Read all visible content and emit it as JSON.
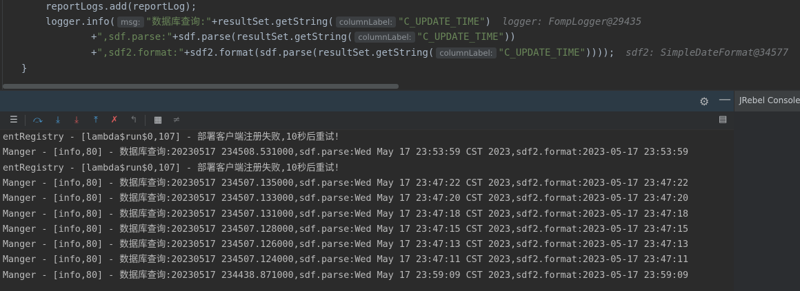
{
  "editor": {
    "line1": {
      "code": "reportLogs.add(reportLog);"
    },
    "line2": {
      "prefix": "logger.info(",
      "hint": "msg:",
      "str": "\"数据库查询:\"",
      "mid": "+resultSet.getString(",
      "hint2": "columnLabel:",
      "str2": "\"C_UPDATE_TIME\"",
      "end": ")",
      "dbg": "logger: FompLogger@29435"
    },
    "line3": {
      "plus": "+",
      "str": "\",sdf.parse:\"",
      "mid": "+sdf.parse(resultSet.getString(",
      "hint": "columnLabel:",
      "str2": "\"C_UPDATE_TIME\"",
      "end": "))"
    },
    "line4": {
      "plus": "+",
      "str": "\",sdf2.format:\"",
      "mid": "+sdf2.format(sdf.parse(resultSet.getString(",
      "hint": "columnLabel:",
      "str2": "\"C_UPDATE_TIME\"",
      "end": "))));",
      "dbg": "sdf2: SimpleDateFormat@34577"
    },
    "line5": {
      "code": "}"
    }
  },
  "panel": {
    "tab_label": "JRebel Console",
    "gear_icon": "gear-icon",
    "minimize_icon": "minimize-icon"
  },
  "toolbar": {
    "icons": [
      "menu-icon",
      "scroll-to-end-icon",
      "download-icon",
      "download-red-icon",
      "upload-icon",
      "filter-clear-icon",
      "pin-icon",
      "print-icon",
      "settings-list-icon"
    ]
  },
  "log_lines": [
    "entRegistry - [lambda$run$0,107] - 部署客户端注册失败,10秒后重试!",
    "Manger - [info,80] - 数据库查询:20230517 234508.531000,sdf.parse:Wed May 17 23:53:59 CST 2023,sdf2.format:2023-05-17 23:53:59",
    "entRegistry - [lambda$run$0,107] - 部署客户端注册失败,10秒后重试!",
    "Manger - [info,80] - 数据库查询:20230517 234507.135000,sdf.parse:Wed May 17 23:47:22 CST 2023,sdf2.format:2023-05-17 23:47:22",
    "Manger - [info,80] - 数据库查询:20230517 234507.133000,sdf.parse:Wed May 17 23:47:20 CST 2023,sdf2.format:2023-05-17 23:47:20",
    "Manger - [info,80] - 数据库查询:20230517 234507.131000,sdf.parse:Wed May 17 23:47:18 CST 2023,sdf2.format:2023-05-17 23:47:18",
    "Manger - [info,80] - 数据库查询:20230517 234507.128000,sdf.parse:Wed May 17 23:47:15 CST 2023,sdf2.format:2023-05-17 23:47:15",
    "Manger - [info,80] - 数据库查询:20230517 234507.126000,sdf.parse:Wed May 17 23:47:13 CST 2023,sdf2.format:2023-05-17 23:47:13",
    "Manger - [info,80] - 数据库查询:20230517 234507.124000,sdf.parse:Wed May 17 23:47:11 CST 2023,sdf2.format:2023-05-17 23:47:11",
    "Manger - [info,80] - 数据库查询:20230517 234438.871000,sdf.parse:Wed May 17 23:59:09 CST 2023,sdf2.format:2023-05-17 23:59:09"
  ]
}
